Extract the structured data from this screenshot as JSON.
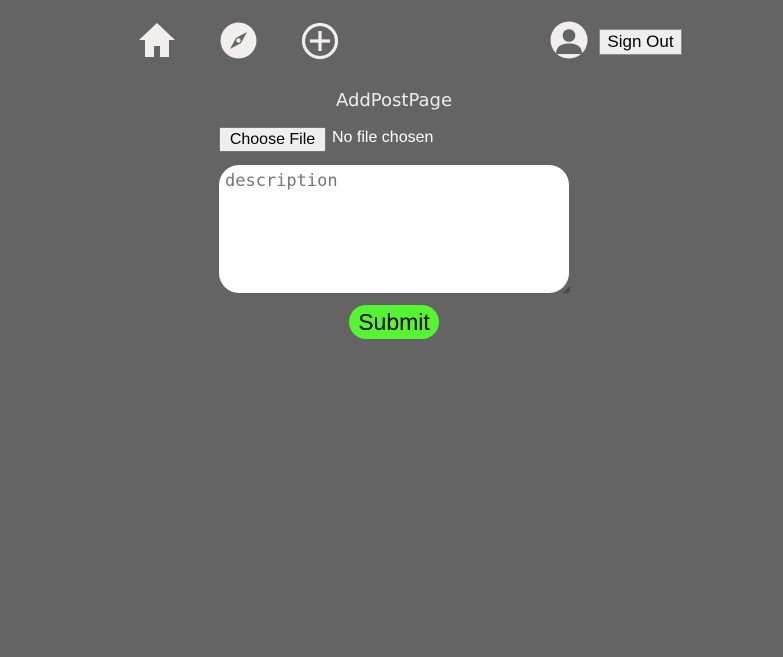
{
  "nav": {
    "icons": {
      "home": "home-icon",
      "explore": "compass-icon",
      "add_post": "plus-circle-icon",
      "profile": "user-avatar-icon"
    },
    "sign_out_label": "Sign Out",
    "icon_color": "#f3eeee"
  },
  "page": {
    "title": "AddPostPage",
    "background_color": "#646464"
  },
  "form": {
    "file_button_label": "Choose File",
    "file_status": "No file chosen",
    "description_placeholder": "description",
    "description_value": "",
    "submit_label": "Submit",
    "submit_color": "#55f532"
  }
}
